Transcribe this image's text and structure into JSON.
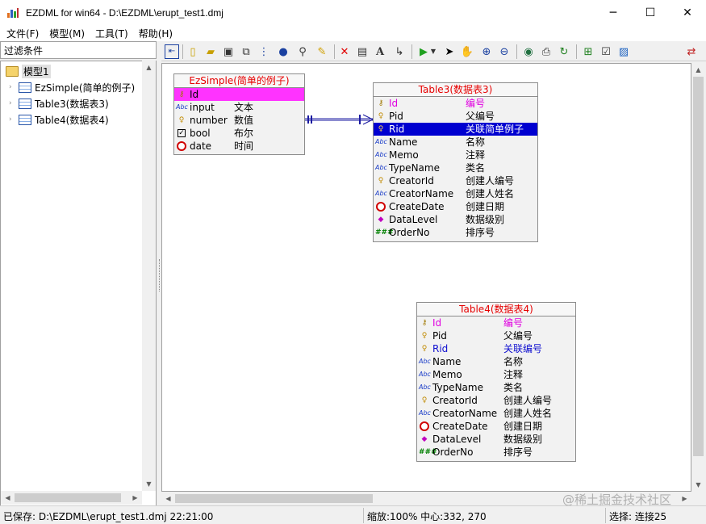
{
  "window": {
    "title": "EZDML for win64 - D:\\EZDML\\erupt_test1.dmj",
    "minimize_glyph": "─",
    "maximize_glyph": "☐",
    "close_glyph": "✕"
  },
  "menu": [
    "文件(F)",
    "模型(M)",
    "工具(T)",
    "帮助(H)"
  ],
  "sidebar": {
    "filter_label": "过滤条件",
    "root": "模型1",
    "items": [
      {
        "label": "EzSimple(简单的例子)"
      },
      {
        "label": "Table3(数据表3)"
      },
      {
        "label": "Table4(数据表4)"
      }
    ]
  },
  "toolbar_icons": [
    "toggle-panel-icon",
    "new-icon",
    "open-icon",
    "save-icon",
    "copy-icon",
    "tree-icon",
    "globe-icon",
    "find-icon",
    "highlight-icon",
    "delete-icon",
    "table-icon",
    "text-icon",
    "link-icon",
    "run-icon",
    "dropdown-icon",
    "pointer-icon",
    "pan-icon",
    "zoom-in-icon",
    "zoom-out-icon",
    "view-icon",
    "print-icon",
    "refresh-icon",
    "add-table-icon",
    "properties-icon",
    "image-icon",
    "switch-icon"
  ],
  "entities": {
    "ezsimple": {
      "title": "EzSimple(简单的例子)",
      "fields": [
        {
          "icon": "key-icon",
          "name": "Id",
          "cn": ""
        },
        {
          "icon": "abc-icon",
          "name": "input",
          "cn": "文本"
        },
        {
          "icon": "bulb-icon",
          "name": "number",
          "cn": "数值"
        },
        {
          "icon": "checkbox-icon",
          "name": "bool",
          "cn": "布尔"
        },
        {
          "icon": "clock-icon",
          "name": "date",
          "cn": "时间"
        }
      ]
    },
    "table3": {
      "title": "Table3(数据表3)",
      "fields": [
        {
          "icon": "key-icon",
          "name": "Id",
          "cn": "编号"
        },
        {
          "icon": "bulb-icon",
          "name": "Pid",
          "cn": "父编号"
        },
        {
          "icon": "bulb-icon",
          "name": "Rid",
          "cn": "关联简单例子"
        },
        {
          "icon": "abc-icon",
          "name": "Name",
          "cn": "名称"
        },
        {
          "icon": "abc-icon",
          "name": "Memo",
          "cn": "注释"
        },
        {
          "icon": "abc-icon",
          "name": "TypeName",
          "cn": "类名"
        },
        {
          "icon": "bulb-icon",
          "name": "CreatorId",
          "cn": "创建人编号"
        },
        {
          "icon": "abc-icon",
          "name": "CreatorName",
          "cn": "创建人姓名"
        },
        {
          "icon": "clock-icon",
          "name": "CreateDate",
          "cn": "创建日期"
        },
        {
          "icon": "diamond-icon",
          "name": "DataLevel",
          "cn": "数据级别"
        },
        {
          "icon": "hash-icon",
          "name": "OrderNo",
          "cn": "排序号"
        }
      ]
    },
    "table4": {
      "title": "Table4(数据表4)",
      "fields": [
        {
          "icon": "key-icon",
          "name": "Id",
          "cn": "编号"
        },
        {
          "icon": "bulb-icon",
          "name": "Pid",
          "cn": "父编号"
        },
        {
          "icon": "bulb-icon",
          "name": "Rid",
          "cn": "关联编号"
        },
        {
          "icon": "abc-icon",
          "name": "Name",
          "cn": "名称"
        },
        {
          "icon": "abc-icon",
          "name": "Memo",
          "cn": "注释"
        },
        {
          "icon": "abc-icon",
          "name": "TypeName",
          "cn": "类名"
        },
        {
          "icon": "bulb-icon",
          "name": "CreatorId",
          "cn": "创建人编号"
        },
        {
          "icon": "abc-icon",
          "name": "CreatorName",
          "cn": "创建人姓名"
        },
        {
          "icon": "clock-icon",
          "name": "CreateDate",
          "cn": "创建日期"
        },
        {
          "icon": "diamond-icon",
          "name": "DataLevel",
          "cn": "数据级别"
        },
        {
          "icon": "hash-icon",
          "name": "OrderNo",
          "cn": "排序号"
        }
      ]
    }
  },
  "status": {
    "saved": "已保存: D:\\EZDML\\erupt_test1.dmj 22:21:00",
    "zoom": "缩放:100% 中心:332, 270",
    "selection": "选择: 连接25"
  },
  "watermark": "@稀土掘金技术社区",
  "colors": {
    "entity_title": "#e60000",
    "pk_highlight": "#ff33ff",
    "selected_row": "#0000d0",
    "fk_text": "#1010d0"
  }
}
